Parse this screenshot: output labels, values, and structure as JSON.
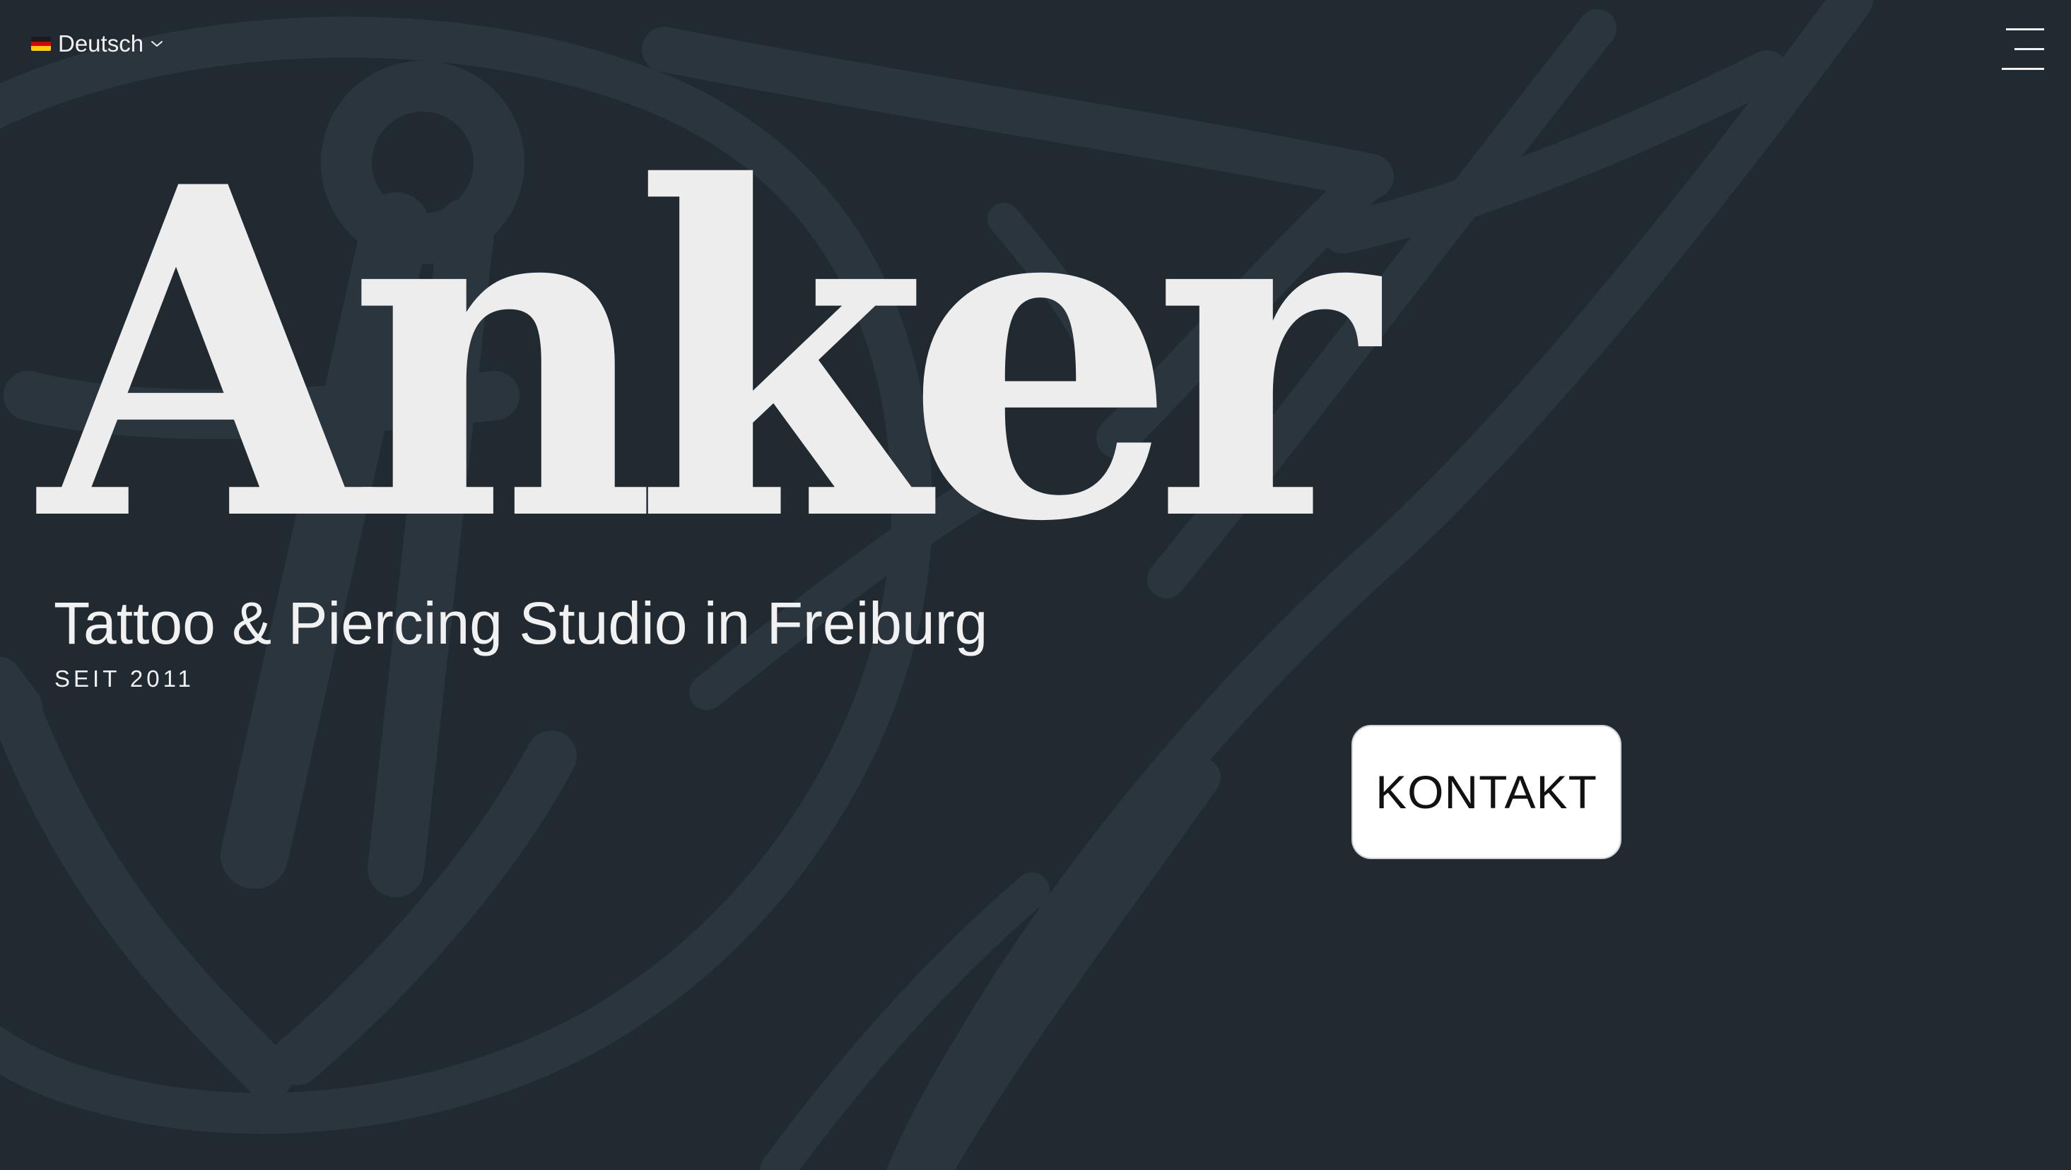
{
  "colors": {
    "background": "#212a31",
    "background_art": "#2b353d",
    "text": "#ededed",
    "button_bg": "#ffffff",
    "button_text": "#111111",
    "flag_black": "#1a1a1a",
    "flag_red": "#dd0000",
    "flag_gold": "#ffce00"
  },
  "header": {
    "language": {
      "label": "Deutsch",
      "flag_icon": "german-flag-icon",
      "chevron_icon": "chevron-down-icon"
    },
    "menu_icon": "hamburger-menu-icon"
  },
  "hero": {
    "title": "Anker",
    "subtitle": "Tattoo & Piercing Studio in Freiburg",
    "since": "SEIT 2011",
    "cta_label": "KONTAKT"
  },
  "background_icons": [
    "anchor-icon",
    "swallow-bird-icon"
  ]
}
